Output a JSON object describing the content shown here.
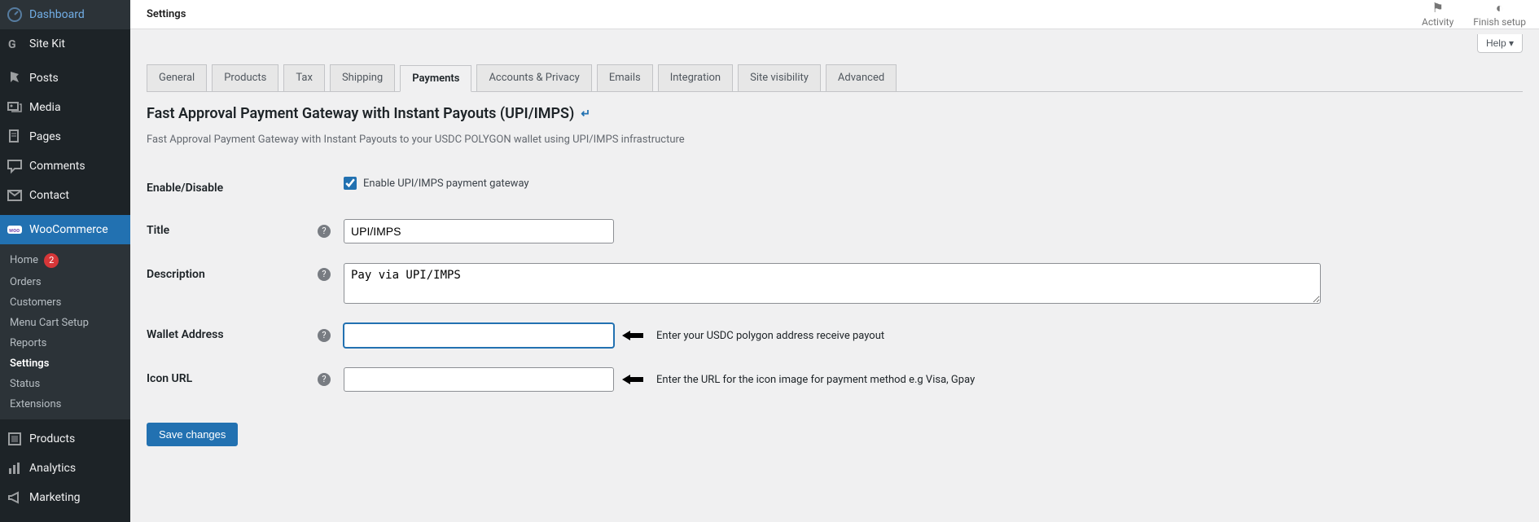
{
  "sidebar": {
    "items": [
      {
        "label": "Dashboard",
        "icon": "dashboard"
      },
      {
        "label": "Site Kit",
        "icon": "sitekit"
      },
      {
        "label": "Posts",
        "icon": "posts"
      },
      {
        "label": "Media",
        "icon": "media"
      },
      {
        "label": "Pages",
        "icon": "pages"
      },
      {
        "label": "Comments",
        "icon": "comments"
      },
      {
        "label": "Contact",
        "icon": "contact"
      },
      {
        "label": "WooCommerce",
        "icon": "woo",
        "current": true
      },
      {
        "label": "Products",
        "icon": "products"
      },
      {
        "label": "Analytics",
        "icon": "analytics"
      },
      {
        "label": "Marketing",
        "icon": "marketing"
      }
    ],
    "woo_submenu": [
      {
        "label": "Home",
        "badge": "2"
      },
      {
        "label": "Orders"
      },
      {
        "label": "Customers"
      },
      {
        "label": "Menu Cart Setup"
      },
      {
        "label": "Reports"
      },
      {
        "label": "Settings",
        "current": true
      },
      {
        "label": "Status"
      },
      {
        "label": "Extensions"
      }
    ]
  },
  "topbar": {
    "breadcrumb": "Settings",
    "activity": "Activity",
    "finish_setup": "Finish setup",
    "help": "Help ▾"
  },
  "tabs": [
    "General",
    "Products",
    "Tax",
    "Shipping",
    "Payments",
    "Accounts & Privacy",
    "Emails",
    "Integration",
    "Site visibility",
    "Advanced"
  ],
  "active_tab": "Payments",
  "section": {
    "title": "Fast Approval Payment Gateway with Instant Payouts (UPI/IMPS)",
    "back_glyph": "↵",
    "desc": "Fast Approval Payment Gateway with Instant Payouts to your USDC POLYGON wallet using UPI/IMPS infrastructure"
  },
  "form": {
    "enable_label": "Enable/Disable",
    "enable_checkbox_label": "Enable UPI/IMPS payment gateway",
    "enable_checked": true,
    "title_label": "Title",
    "title_value": "UPI/IMPS",
    "description_label": "Description",
    "description_value": "Pay via UPI/IMPS",
    "wallet_label": "Wallet Address",
    "wallet_value": "",
    "wallet_hint": "Enter your USDC polygon address receive payout",
    "icon_label": "Icon URL",
    "icon_value": "",
    "icon_hint": "Enter the URL for the icon image for payment method e.g Visa, Gpay",
    "save_label": "Save changes",
    "help_tip_glyph": "?"
  }
}
